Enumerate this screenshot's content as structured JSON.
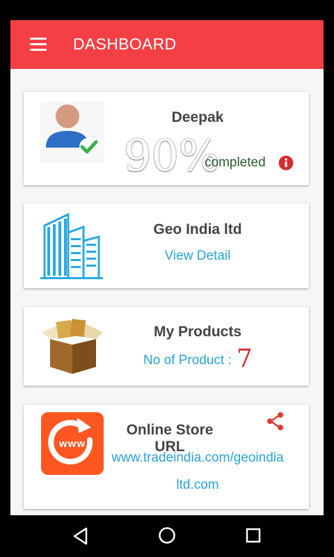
{
  "app": {
    "title": "DASHBOARD",
    "accent_color": "#f44045",
    "link_color": "#2aa3d8"
  },
  "profile": {
    "name": "Deepak",
    "completion_percent": "90%",
    "completion_label": "completed",
    "icons": [
      "user-avatar-icon",
      "check-icon",
      "info-icon"
    ]
  },
  "company": {
    "name": "Geo India ltd",
    "link_label": "View Detail",
    "icon": "building-icon"
  },
  "products": {
    "title": "My Products",
    "count_label": "No of Product :",
    "count": "7",
    "icon": "product-box-icon"
  },
  "store": {
    "title": "Online Store URL",
    "url_line1": "www.tradeindia.com/geoindia",
    "url_line2": "ltd.com",
    "icons": [
      "www-refresh-icon",
      "share-icon"
    ]
  },
  "navbar": {
    "icons": [
      "back-icon",
      "home-icon",
      "recents-icon"
    ]
  }
}
